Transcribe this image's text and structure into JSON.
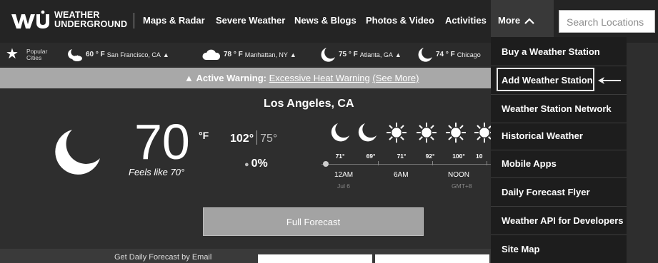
{
  "header": {
    "logo_text_line1": "WEATHER",
    "logo_text_line2": "UNDERGROUND",
    "nav": [
      "Maps & Radar",
      "Severe Weather",
      "News & Blogs",
      "Photos & Video",
      "Activities"
    ],
    "more_label": "More",
    "search_placeholder": "Search Locations"
  },
  "popular": {
    "label_line1": "Popular",
    "label_line2": "Cities",
    "cities": [
      {
        "temp": "60 ° F",
        "name": "San Francisco, CA",
        "icon": "moon-cloud-icon",
        "warning": true
      },
      {
        "temp": "78 ° F",
        "name": "Manhattan, NY",
        "icon": "cloud-icon",
        "warning": true
      },
      {
        "temp": "75 ° F",
        "name": "Atlanta, GA",
        "icon": "moon-icon",
        "warning": true
      },
      {
        "temp": "74 ° F",
        "name": "Chicago",
        "icon": "moon-icon",
        "warning": false
      }
    ]
  },
  "warning": {
    "prefix": "Active Warning:",
    "link": "Excessive Heat Warning",
    "see_more": "(See More)"
  },
  "current": {
    "location": "Los Angeles, CA",
    "temp": "70",
    "unit": "°F",
    "feels_like": "Feels like 70°",
    "high": "102°",
    "low": "75°",
    "precip": "0%"
  },
  "forecast": {
    "temps": [
      "71°",
      "69°",
      "71°",
      "92°",
      "100°",
      "10"
    ],
    "icons": [
      "moon-icon",
      "moon-icon",
      "sun-icon",
      "sun-icon",
      "sun-icon",
      "sun-icon"
    ],
    "times": [
      "12AM",
      "6AM",
      "NOON"
    ],
    "date": "Jul 6",
    "tz": "GMT+8"
  },
  "full_forecast_label": "Full Forecast",
  "bottom_text": "Get Daily Forecast by Email",
  "dropdown": {
    "items": [
      "Buy a Weather Station",
      "Add Weather Station",
      "Weather Station Network",
      "Historical Weather",
      "Mobile Apps",
      "Daily Forecast Flyer",
      "Weather API for Developers",
      "Site Map"
    ]
  },
  "colors": {
    "nav_bg": "#242424",
    "page_bg": "#2e2e2e",
    "warning_bar": "#a8a8a8",
    "button": "#a3a3a3",
    "dropdown_bg": "#1d1d1d"
  }
}
